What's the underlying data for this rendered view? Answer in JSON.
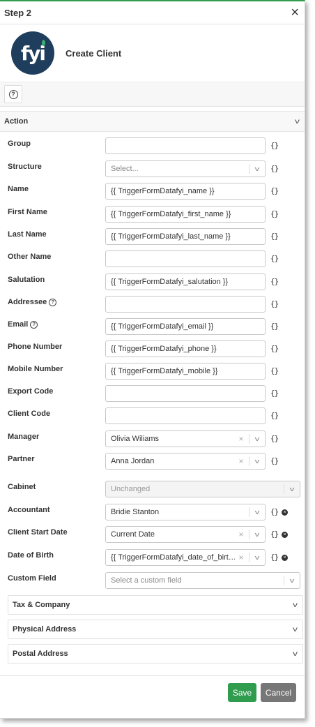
{
  "header": {
    "title": "Step 2",
    "close_glyph": "×"
  },
  "app": {
    "logo_text": "fyi",
    "name": "Create Client"
  },
  "section": {
    "label": "Action"
  },
  "fields": [
    {
      "key": "group",
      "label": "Group",
      "type": "text",
      "value": ""
    },
    {
      "key": "structure",
      "label": "Structure",
      "type": "select",
      "placeholder": "Select..."
    },
    {
      "key": "name",
      "label": "Name",
      "type": "text",
      "value": "{{ TriggerFormDatafyi_name }}"
    },
    {
      "key": "first_name",
      "label": "First Name",
      "type": "text",
      "value": "{{ TriggerFormDatafyi_first_name }}"
    },
    {
      "key": "last_name",
      "label": "Last Name",
      "type": "text",
      "value": "{{ TriggerFormDatafyi_last_name }}"
    },
    {
      "key": "other_name",
      "label": "Other Name",
      "type": "text",
      "value": ""
    },
    {
      "key": "salutation",
      "label": "Salutation",
      "type": "text",
      "value": "{{ TriggerFormDatafyi_salutation }}"
    },
    {
      "key": "addressee",
      "label": "Addressee",
      "type": "text",
      "value": "",
      "help": true
    },
    {
      "key": "email",
      "label": "Email",
      "type": "text",
      "value": "{{ TriggerFormDatafyi_email }}",
      "help": true
    },
    {
      "key": "phone_number",
      "label": "Phone Number",
      "type": "text",
      "value": "{{ TriggerFormDatafyi_phone }}"
    },
    {
      "key": "mobile_number",
      "label": "Mobile Number",
      "type": "text",
      "value": "{{ TriggerFormDatafyi_mobile }}"
    },
    {
      "key": "export_code",
      "label": "Export Code",
      "type": "text",
      "value": ""
    },
    {
      "key": "client_code",
      "label": "Client Code",
      "type": "text",
      "value": ""
    },
    {
      "key": "manager",
      "label": "Manager",
      "type": "select",
      "value": "Olivia Wiliams",
      "clearable": true
    },
    {
      "key": "partner",
      "label": "Partner",
      "type": "select",
      "value": "Anna Jordan",
      "clearable": true
    },
    {
      "key": "cabinet",
      "label": "Cabinet",
      "type": "select",
      "value": "Unchanged",
      "disabled": true
    },
    {
      "key": "accountant",
      "label": "Accountant",
      "type": "select",
      "value": "Bridie Stanton",
      "removable": true
    },
    {
      "key": "client_start_date",
      "label": "Client Start Date",
      "type": "select",
      "value": "Current Date",
      "clearable": true,
      "removable": true
    },
    {
      "key": "date_of_birth",
      "label": "Date of Birth",
      "type": "select",
      "value": "{{ TriggerFormDatafyi_date_of_birt…",
      "clearable": true,
      "removable": true
    },
    {
      "key": "custom_field",
      "label": "Custom Field",
      "type": "select",
      "placeholder": "Select a custom field",
      "wide": true
    }
  ],
  "subsections": [
    {
      "label": "Tax & Company"
    },
    {
      "label": "Physical Address"
    },
    {
      "label": "Postal Address"
    }
  ],
  "glyphs": {
    "brace": "{}",
    "clear": "×",
    "caret": "v",
    "chevron": "v",
    "help": "?"
  },
  "footer": {
    "save_label": "Save",
    "cancel_label": "Cancel"
  },
  "colors": {
    "accent": "#2f9c4e",
    "cancel": "#777777",
    "logo_bg": "#1f3d5c"
  }
}
